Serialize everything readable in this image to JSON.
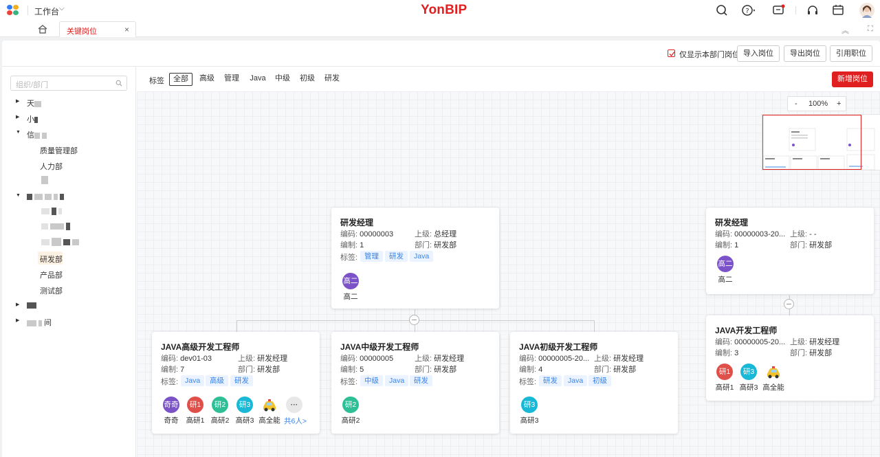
{
  "topbar": {
    "workbench": "工作台",
    "brand": "YonBIP",
    "icons": [
      "search-icon",
      "help-icon",
      "message-icon",
      "headset-icon",
      "calendar-icon",
      "avatar"
    ]
  },
  "tabs": {
    "active": "关键岗位"
  },
  "toolbar": {
    "checkbox_label": "仅显示本部门岗位",
    "checkbox_checked": true,
    "import_label": "导入岗位",
    "export_label": "导出岗位",
    "reference_label": "引用职位"
  },
  "tree": {
    "search_placeholder": "组织/部门",
    "items": [
      {
        "text": "天",
        "selected": false
      },
      {
        "text": "小",
        "selected": false
      },
      {
        "text": "信",
        "selected": false
      },
      {
        "text": "质量管理部",
        "selected": false
      },
      {
        "text": "人力部",
        "selected": false
      },
      {
        "text": "研发部",
        "selected": true
      },
      {
        "text": "产品部",
        "selected": false
      },
      {
        "text": "测试部",
        "selected": false
      },
      {
        "text": "间",
        "selected": false
      }
    ]
  },
  "filters": {
    "label": "标签",
    "tags": [
      "全部",
      "高级",
      "管理",
      "Java",
      "中级",
      "初级",
      "研发"
    ],
    "active": "全部",
    "add_label": "新增岗位"
  },
  "zoom": {
    "minus": "-",
    "level": "100%",
    "plus": "+"
  },
  "labels": {
    "code": "编码:",
    "parent": "上级:",
    "staffing": "编制:",
    "dept": "部门:",
    "tags": "标签:"
  },
  "cards": [
    {
      "title": "研发经理",
      "code": "00000003",
      "parent": "总经理",
      "staffing": "1",
      "dept": "研发部",
      "tags": [
        "管理",
        "研发",
        "Java"
      ],
      "members": [
        {
          "avatar_text": "高二",
          "name": "高二",
          "color": "#7b52c7"
        }
      ]
    },
    {
      "title": "JAVA高级开发工程师",
      "code": "dev01-03",
      "parent": "研发经理",
      "staffing": "7",
      "dept": "研发部",
      "tags": [
        "Java",
        "高级",
        "研发"
      ],
      "members": [
        {
          "avatar_text": "奇奇",
          "name": "奇奇",
          "color": "#7b52c7"
        },
        {
          "avatar_text": "研1",
          "name": "高研1",
          "color": "#e0504a"
        },
        {
          "avatar_text": "研2",
          "name": "高研2",
          "color": "#2fbf96"
        },
        {
          "avatar_text": "研3",
          "name": "高研3",
          "color": "#18b8d6"
        },
        {
          "avatar_text": "",
          "name": "高全能",
          "color": "",
          "car": true
        },
        {
          "avatar_text": "···",
          "name": "",
          "color": "#e8e8e8",
          "more": true
        }
      ],
      "more_link": "共6人>"
    },
    {
      "title": "JAVA中级开发工程师",
      "code": "00000005",
      "parent": "研发经理",
      "staffing": "5",
      "dept": "研发部",
      "tags": [
        "中级",
        "Java",
        "研发"
      ],
      "members": [
        {
          "avatar_text": "研2",
          "name": "高研2",
          "color": "#2fbf96"
        }
      ]
    },
    {
      "title": "JAVA初级开发工程师",
      "code": "00000005-20...",
      "parent": "研发经理",
      "staffing": "4",
      "dept": "研发部",
      "tags": [
        "研发",
        "Java",
        "初级"
      ],
      "members": [
        {
          "avatar_text": "研3",
          "name": "高研3",
          "color": "#18b8d6"
        }
      ]
    },
    {
      "title": "研发经理",
      "code": "00000003-20...",
      "parent": "- -",
      "staffing": "1",
      "dept": "研发部",
      "tags": [],
      "members": [
        {
          "avatar_text": "高二",
          "name": "高二",
          "color": "#7b52c7"
        }
      ]
    },
    {
      "title": "JAVA开发工程师",
      "code": "00000005-20...",
      "parent": "研发经理",
      "staffing": "3",
      "dept": "研发部",
      "tags": [],
      "members": [
        {
          "avatar_text": "研1",
          "name": "高研1",
          "color": "#e0504a"
        },
        {
          "avatar_text": "研3",
          "name": "高研3",
          "color": "#18b8d6"
        },
        {
          "avatar_text": "",
          "name": "高全能",
          "color": "",
          "car": true
        }
      ]
    }
  ],
  "colors": {
    "brand": "#e02020",
    "tag_bg": "#eaf3ff",
    "tag_text": "#3a83e8",
    "selected_tree_bg": "#fdf1e3"
  }
}
